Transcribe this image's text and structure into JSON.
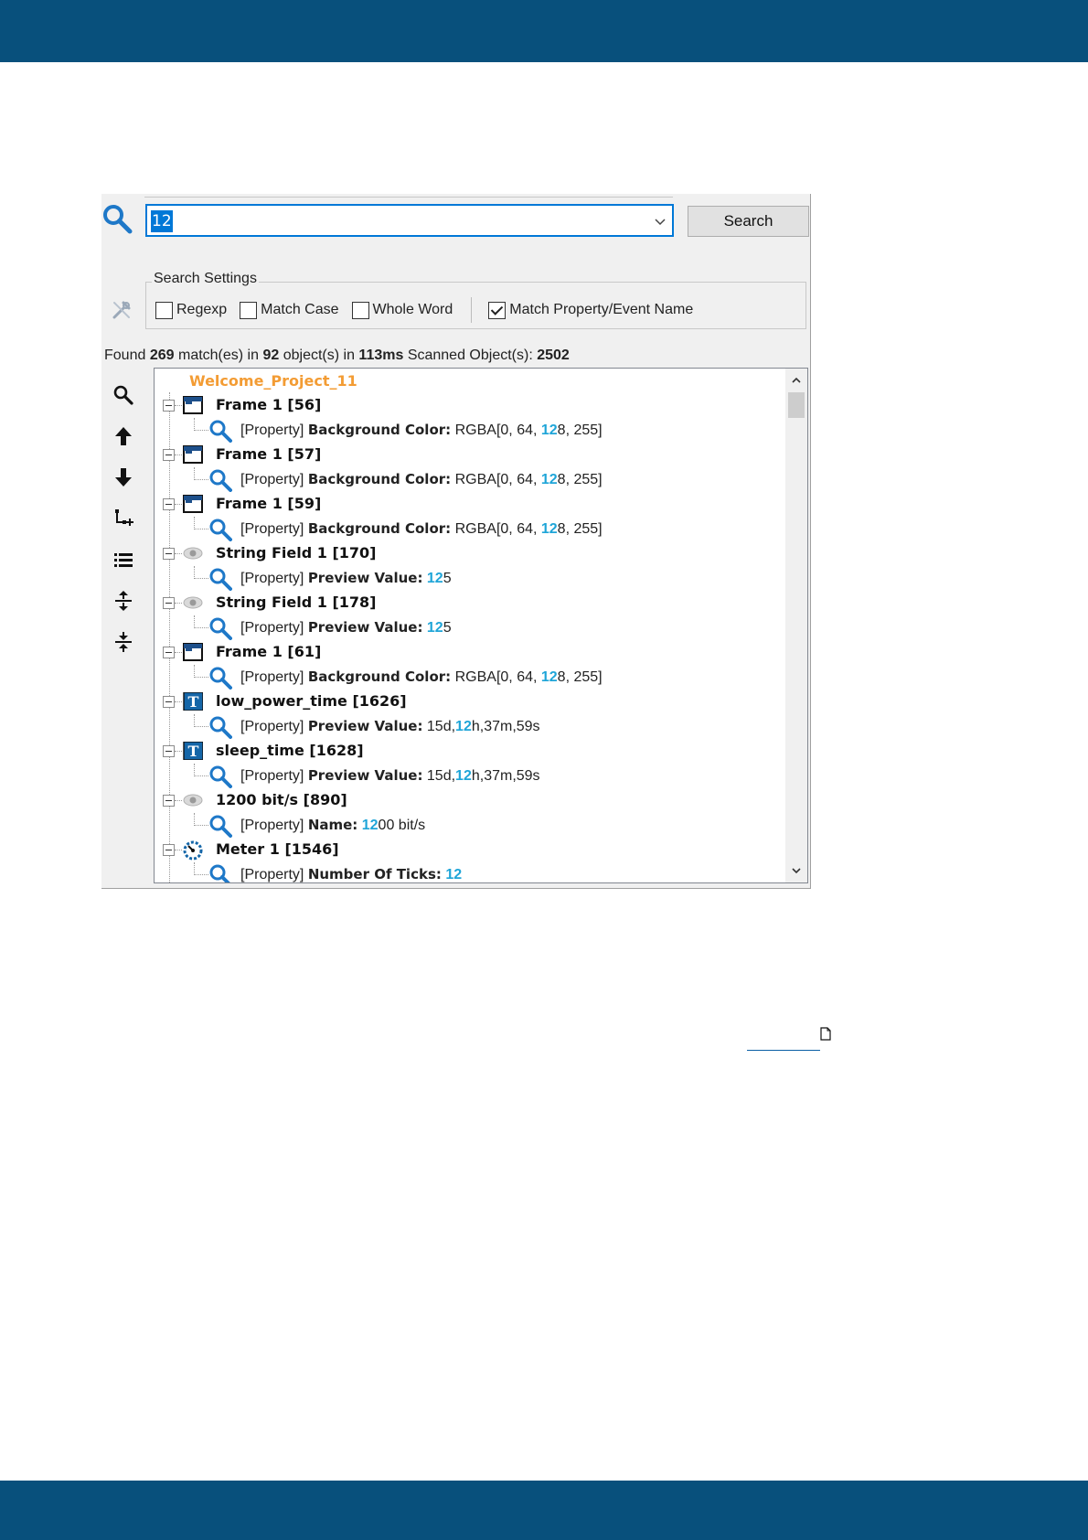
{
  "search": {
    "value": "12",
    "button_label": "Search"
  },
  "settings": {
    "legend": "Search Settings",
    "options": [
      {
        "label": "Regexp",
        "checked": false
      },
      {
        "label": "Match Case",
        "checked": false
      },
      {
        "label": "Whole Word",
        "checked": false
      },
      {
        "label": "Match Property/Event Name",
        "checked": true
      }
    ]
  },
  "found": {
    "prefix": "Found",
    "matches": "269",
    "matches_text": "match(es) in",
    "objects": "92",
    "objects_text": "object(s) in",
    "time": "113ms",
    "scanned_text": "Scanned Object(s):",
    "scanned": "2502"
  },
  "tree": {
    "root": "Welcome_Project_11",
    "items": [
      {
        "icon": "frame-icon",
        "label": "Frame 1 [56]",
        "child": {
          "tag": "[Property]",
          "name": "Background Color:",
          "pre": "RGBA[0, 64, ",
          "hl": "12",
          "post": "8, 255]"
        }
      },
      {
        "icon": "frame-icon",
        "label": "Frame 1 [57]",
        "child": {
          "tag": "[Property]",
          "name": "Background Color:",
          "pre": "RGBA[0, 64, ",
          "hl": "12",
          "post": "8, 255]"
        }
      },
      {
        "icon": "frame-icon",
        "label": "Frame 1 [59]",
        "child": {
          "tag": "[Property]",
          "name": "Background Color:",
          "pre": "RGBA[0, 64, ",
          "hl": "12",
          "post": "8, 255]"
        }
      },
      {
        "icon": "eye-icon",
        "label": "String Field 1 [170]",
        "child": {
          "tag": "[Property]",
          "name": "Preview Value:",
          "pre": "",
          "hl": "12",
          "post": "5"
        }
      },
      {
        "icon": "eye-icon",
        "label": "String Field 1 [178]",
        "child": {
          "tag": "[Property]",
          "name": "Preview Value:",
          "pre": "",
          "hl": "12",
          "post": "5"
        }
      },
      {
        "icon": "frame-icon",
        "label": "Frame 1 [61]",
        "child": {
          "tag": "[Property]",
          "name": "Background Color:",
          "pre": "RGBA[0, 64, ",
          "hl": "12",
          "post": "8, 255]"
        }
      },
      {
        "icon": "text-icon",
        "label": "low_power_time [1626]",
        "child": {
          "tag": "[Property]",
          "name": "Preview Value:",
          "pre": "15d,",
          "hl": "12",
          "post": "h,37m,59s"
        }
      },
      {
        "icon": "text-icon",
        "label": "sleep_time [1628]",
        "child": {
          "tag": "[Property]",
          "name": "Preview Value:",
          "pre": "15d,",
          "hl": "12",
          "post": "h,37m,59s"
        }
      },
      {
        "icon": "eye-icon",
        "label": "1200 bit/s [890]",
        "child": {
          "tag": "[Property]",
          "name": "Name:",
          "pre": "",
          "hl": "12",
          "post": "00 bit/s"
        }
      },
      {
        "icon": "meter-icon",
        "label": "Meter 1 [1546]",
        "child": {
          "tag": "[Property]",
          "name": "Number Of Ticks:",
          "pre": "",
          "hl": "12",
          "post": ""
        }
      }
    ]
  },
  "colors": {
    "brand_bar": "#08507c",
    "root_label": "#f39c34",
    "highlight": "#1fa5d8",
    "selection": "#0078d7"
  }
}
